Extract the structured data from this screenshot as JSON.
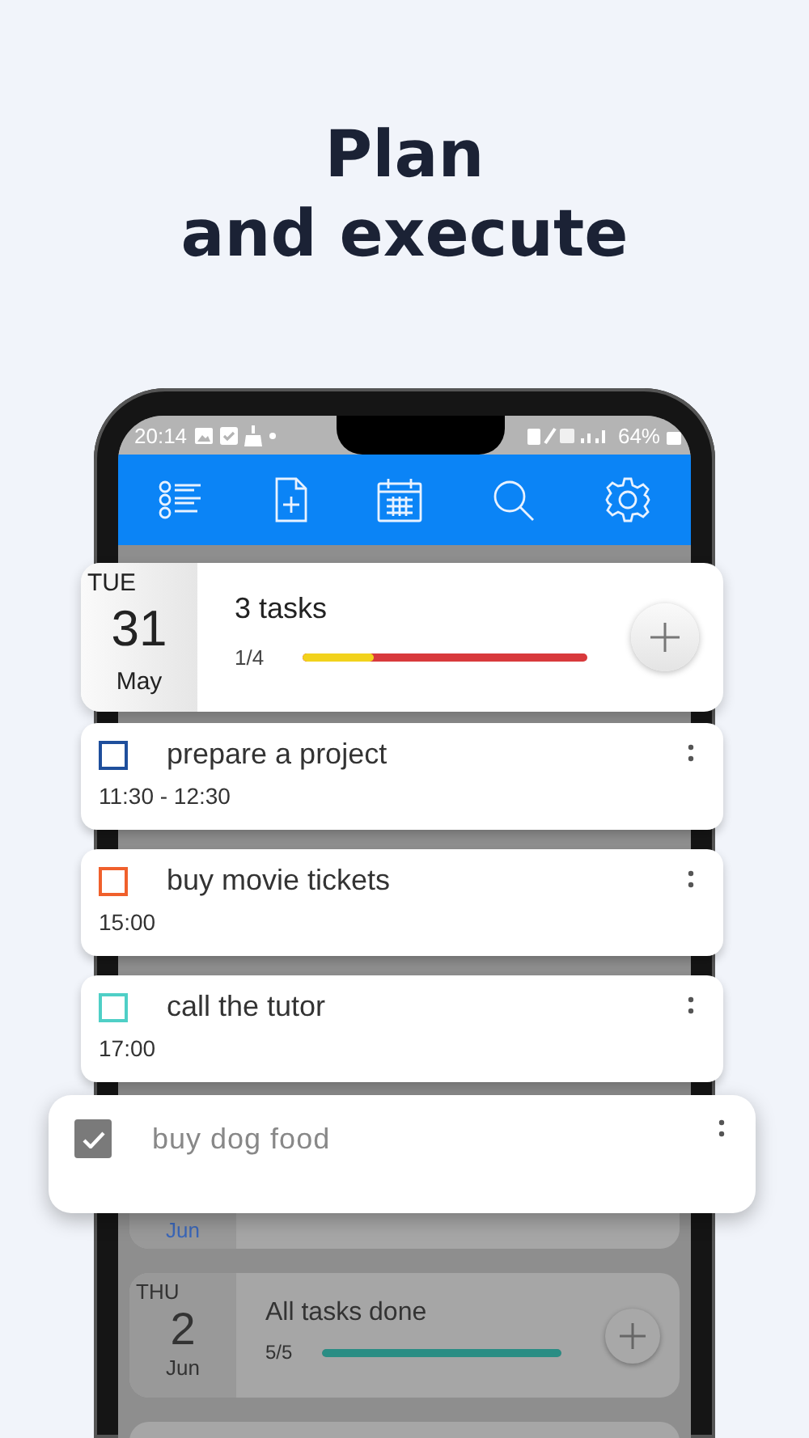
{
  "heading": [
    "Plan",
    "and execute"
  ],
  "status_bar": {
    "time": "20:14",
    "battery": "64%"
  },
  "day": {
    "weekday": "TUE",
    "day": "31",
    "month": "May",
    "title": "3 tasks",
    "count": "1/4",
    "level": 0.25
  },
  "tasks": [
    {
      "title": "prepare a project",
      "time": "11:30 - 12:30",
      "color": "#1f4f9c",
      "checked": false
    },
    {
      "title": "buy movie tickets",
      "time": "15:00",
      "color": "#f0602c",
      "checked": false
    },
    {
      "title": "call the tutor",
      "time": "17:00",
      "color": "#4fcfc6",
      "checked": false
    }
  ],
  "dragged_task": {
    "title": "buy dog food",
    "checked": true
  },
  "background_days": [
    {
      "kind": "partial",
      "month": "Jun"
    },
    {
      "kind": "full",
      "weekday": "THU",
      "day": "2",
      "month": "Jun",
      "title": "All tasks done",
      "count": "5/5",
      "level": 1
    },
    {
      "kind": "top"
    }
  ]
}
